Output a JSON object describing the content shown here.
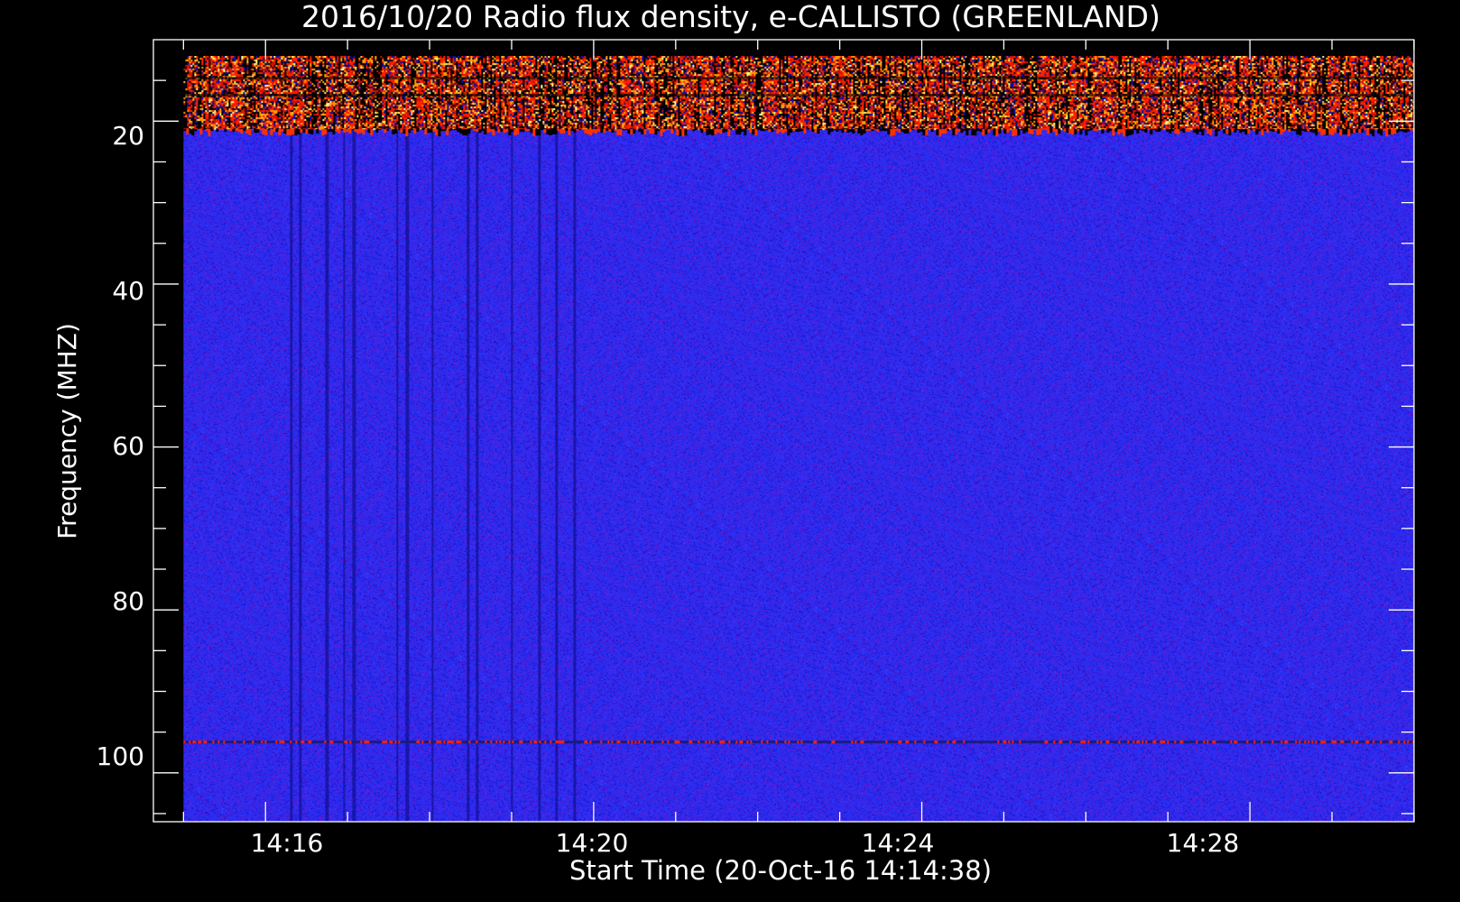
{
  "chart_data": {
    "type": "heatmap",
    "title": "2016/10/20  Radio flux density, e-CALLISTO (GREENLAND)",
    "xlabel": "Start Time (20-Oct-16 14:14:38)",
    "ylabel": "Frequency (MHZ)",
    "x_tick_labels": [
      "14:16",
      "14:20",
      "14:24",
      "14:28"
    ],
    "y_tick_labels": [
      "20",
      "40",
      "60",
      "80",
      "100"
    ],
    "x_range": [
      "14:14:38",
      "14:30:00"
    ],
    "y_range": [
      10,
      106
    ],
    "y_reversed": true,
    "data_time_range": [
      "14:15:00",
      "14:30:00"
    ],
    "data_freq_range": [
      12,
      106
    ],
    "colormap": [
      "#000000",
      "#1010d8",
      "#3333ff",
      "#ff2000",
      "#ff9a00",
      "#ffff80"
    ],
    "background_color": "#2c2cf0",
    "features": [
      {
        "name": "persistent-interference-band",
        "freq_range": [
          12,
          21
        ],
        "level": "high"
      },
      {
        "name": "narrowband-line",
        "freq": 96,
        "level": "medium"
      }
    ]
  }
}
